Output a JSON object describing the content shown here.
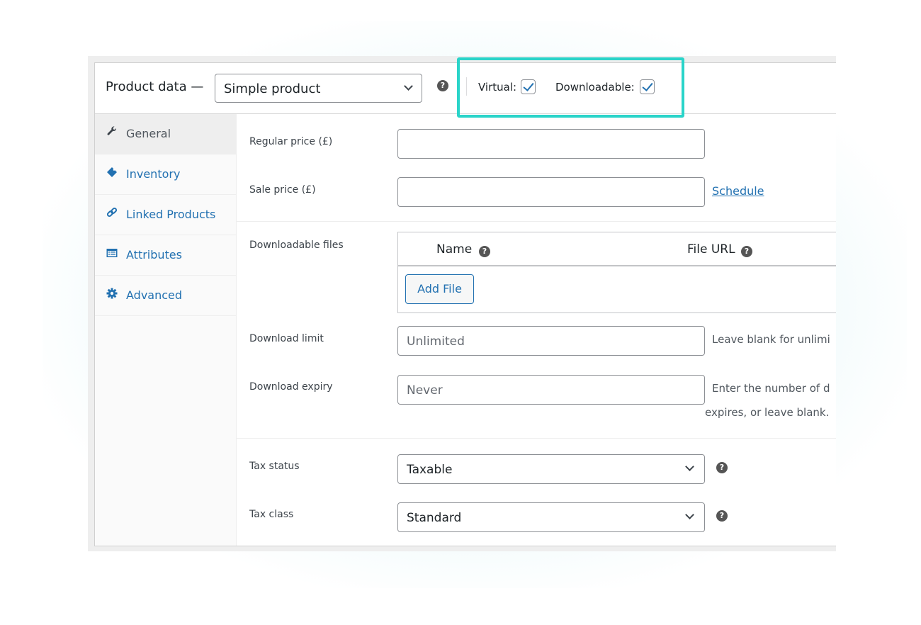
{
  "header": {
    "title": "Product data —",
    "product_type": "Simple product",
    "virtual_label": "Virtual:",
    "virtual_checked": true,
    "downloadable_label": "Downloadable:",
    "downloadable_checked": true,
    "highlight_color": "#2ad4c9"
  },
  "sidebar": {
    "items": [
      {
        "label": "General",
        "icon": "wrench-icon",
        "active": true
      },
      {
        "label": "Inventory",
        "icon": "tag-icon",
        "active": false
      },
      {
        "label": "Linked Products",
        "icon": "link-icon",
        "active": false
      },
      {
        "label": "Attributes",
        "icon": "list-card-icon",
        "active": false
      },
      {
        "label": "Advanced",
        "icon": "gear-icon",
        "active": false
      }
    ]
  },
  "general": {
    "regular_price_label": "Regular price (£)",
    "regular_price_value": "",
    "sale_price_label": "Sale price (£)",
    "sale_price_value": "",
    "schedule_link": "Schedule",
    "downloadable_files_label": "Downloadable files",
    "files_table": {
      "columns": [
        "Name",
        "File URL"
      ],
      "rows": [],
      "add_button": "Add File"
    },
    "download_limit_label": "Download limit",
    "download_limit_placeholder": "Unlimited",
    "download_limit_desc": "Leave blank for unlimi",
    "download_expiry_label": "Download expiry",
    "download_expiry_placeholder": "Never",
    "download_expiry_desc_1": "Enter the number of d",
    "download_expiry_desc_2": "expires, or leave blank.",
    "tax_status_label": "Tax status",
    "tax_status_value": "Taxable",
    "tax_class_label": "Tax class",
    "tax_class_value": "Standard"
  },
  "colors": {
    "accent": "#2271b1",
    "help_icon": "#555555"
  }
}
